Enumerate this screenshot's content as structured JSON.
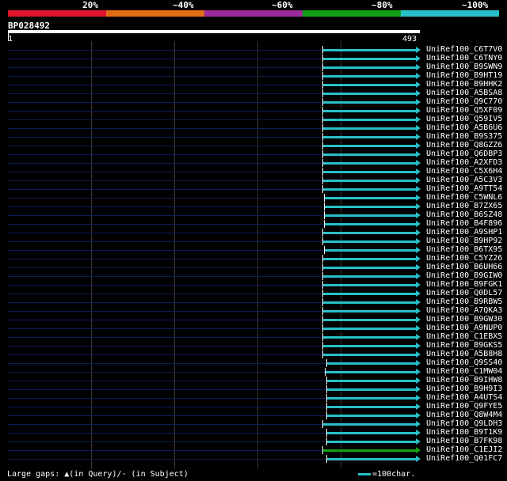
{
  "scale": {
    "segments": [
      {
        "label": "20%",
        "color": "#e0142c"
      },
      {
        "label": "~40%",
        "color": "#e06c14"
      },
      {
        "label": "~60%",
        "color": "#9a2a9a"
      },
      {
        "label": "~80%",
        "color": "#14a014"
      },
      {
        "label": "~100%",
        "color": "#28c0c8"
      }
    ]
  },
  "query": {
    "name": "BP028492",
    "start": "1",
    "end": "493"
  },
  "colors": {
    "hit": "#28c0c8",
    "hit_alt": "#14a014",
    "gap": "#0e1c5a"
  },
  "hits": [
    {
      "label": "UniRef100_C6T7V0",
      "start": 380,
      "color": "#28c0c8"
    },
    {
      "label": "UniRef100_C6TNY0",
      "start": 380,
      "color": "#28c0c8"
    },
    {
      "label": "UniRef100_B9SWN9",
      "start": 380,
      "color": "#28c0c8"
    },
    {
      "label": "UniRef100_B9HT19",
      "start": 380,
      "color": "#28c0c8"
    },
    {
      "label": "UniRef100_B9HHK2",
      "start": 380,
      "color": "#28c0c8"
    },
    {
      "label": "UniRef100_A5BSA8",
      "start": 380,
      "color": "#28c0c8"
    },
    {
      "label": "UniRef100_Q9C770",
      "start": 380,
      "color": "#28c0c8"
    },
    {
      "label": "UniRef100_Q5XF09",
      "start": 380,
      "color": "#28c0c8"
    },
    {
      "label": "UniRef100_Q59IV5",
      "start": 380,
      "color": "#28c0c8"
    },
    {
      "label": "UniRef100_A5B6U6",
      "start": 380,
      "color": "#28c0c8"
    },
    {
      "label": "UniRef100_B9S375",
      "start": 380,
      "color": "#28c0c8"
    },
    {
      "label": "UniRef100_Q8GZZ6",
      "start": 380,
      "color": "#28c0c8"
    },
    {
      "label": "UniRef100_Q6DBP3",
      "start": 380,
      "color": "#28c0c8"
    },
    {
      "label": "UniRef100_A2XFD3",
      "start": 380,
      "color": "#28c0c8"
    },
    {
      "label": "UniRef100_C5X6H4",
      "start": 380,
      "color": "#28c0c8"
    },
    {
      "label": "UniRef100_A5C3V3",
      "start": 380,
      "color": "#28c0c8"
    },
    {
      "label": "UniRef100_A9TT54",
      "start": 380,
      "color": "#28c0c8"
    },
    {
      "label": "UniRef100_C5WNL6",
      "start": 382,
      "color": "#28c0c8"
    },
    {
      "label": "UniRef100_B7ZX65",
      "start": 382,
      "color": "#28c0c8"
    },
    {
      "label": "UniRef100_B6SZ48",
      "start": 382,
      "color": "#28c0c8"
    },
    {
      "label": "UniRef100_B4F896",
      "start": 382,
      "color": "#28c0c8"
    },
    {
      "label": "UniRef100_A9SHP1",
      "start": 380,
      "color": "#28c0c8"
    },
    {
      "label": "UniRef100_B9HP92",
      "start": 380,
      "color": "#28c0c8"
    },
    {
      "label": "UniRef100_B6TX95",
      "start": 382,
      "color": "#28c0c8"
    },
    {
      "label": "UniRef100_C5YZ26",
      "start": 380,
      "color": "#28c0c8"
    },
    {
      "label": "UniRef100_B6UH66",
      "start": 380,
      "color": "#28c0c8"
    },
    {
      "label": "UniRef100_B9GIW0",
      "start": 380,
      "color": "#28c0c8"
    },
    {
      "label": "UniRef100_B9FGK1",
      "start": 380,
      "color": "#28c0c8"
    },
    {
      "label": "UniRef100_Q0DL57",
      "start": 380,
      "color": "#28c0c8"
    },
    {
      "label": "UniRef100_B9RBW5",
      "start": 380,
      "color": "#28c0c8"
    },
    {
      "label": "UniRef100_A7QKA3",
      "start": 380,
      "color": "#28c0c8"
    },
    {
      "label": "UniRef100_B9GW30",
      "start": 380,
      "color": "#28c0c8"
    },
    {
      "label": "UniRef100_A9NUP0",
      "start": 380,
      "color": "#28c0c8"
    },
    {
      "label": "UniRef100_C1EBX5",
      "start": 380,
      "color": "#28c0c8"
    },
    {
      "label": "UniRef100_B9GKS5",
      "start": 380,
      "color": "#28c0c8"
    },
    {
      "label": "UniRef100_A5B8H8",
      "start": 380,
      "color": "#28c0c8"
    },
    {
      "label": "UniRef100_Q9SS40",
      "start": 385,
      "color": "#28c0c8"
    },
    {
      "label": "UniRef100_C1MW04",
      "start": 383,
      "color": "#28c0c8"
    },
    {
      "label": "UniRef100_B9IHW8",
      "start": 385,
      "color": "#28c0c8"
    },
    {
      "label": "UniRef100_B9H9I3",
      "start": 385,
      "color": "#28c0c8"
    },
    {
      "label": "UniRef100_A4UTS4",
      "start": 385,
      "color": "#28c0c8"
    },
    {
      "label": "UniRef100_Q9FYE5",
      "start": 385,
      "color": "#28c0c8"
    },
    {
      "label": "UniRef100_Q8W4M4",
      "start": 385,
      "color": "#28c0c8"
    },
    {
      "label": "UniRef100_Q9LDH3",
      "start": 380,
      "color": "#28c0c8"
    },
    {
      "label": "UniRef100_B9T1K9",
      "start": 385,
      "color": "#28c0c8"
    },
    {
      "label": "UniRef100_B7FK98",
      "start": 385,
      "color": "#28c0c8"
    },
    {
      "label": "UniRef100_C1EJI2",
      "start": 380,
      "color": "#14a014"
    },
    {
      "label": "UniRef100_Q01FC7",
      "start": 385,
      "color": "#28c0c8"
    }
  ],
  "footer": {
    "gaps_text": "Large gaps: ▲(in Query)/- (in Subject)",
    "legend_text": "=100char."
  }
}
